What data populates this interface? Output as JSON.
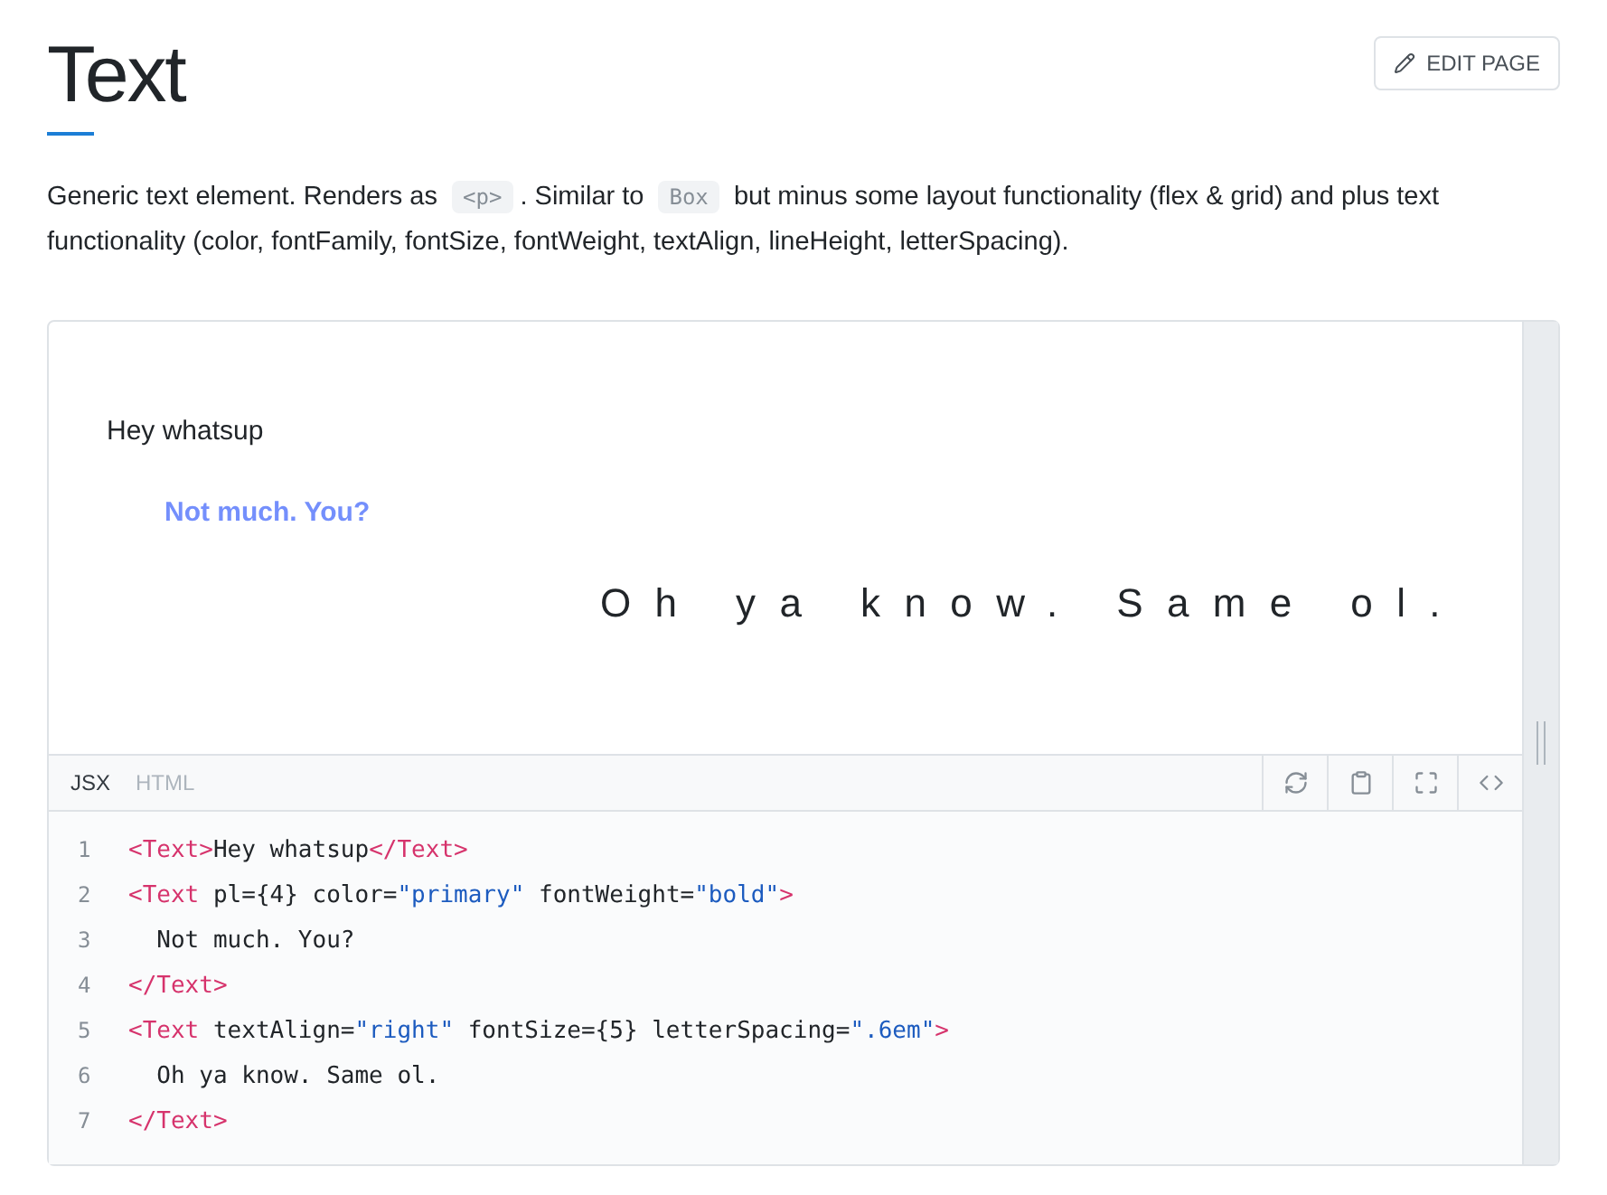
{
  "title": "Text",
  "edit_button": {
    "label": "EDIT PAGE"
  },
  "description": [
    {
      "kind": "text",
      "text": "Generic text element. Renders as "
    },
    {
      "kind": "code",
      "text": "<p>"
    },
    {
      "kind": "text",
      "text": ". Similar to "
    },
    {
      "kind": "code",
      "text": "Box"
    },
    {
      "kind": "text",
      "text": " but minus some layout functionality (flex & grid) and plus text functionality (color, fontFamily, fontSize, fontWeight, textAlign, lineHeight, letterSpacing)."
    }
  ],
  "preview": [
    {
      "kind": "plain",
      "text": "Hey whatsup"
    },
    {
      "kind": "bold",
      "text": "Not much. You?"
    },
    {
      "kind": "spaced",
      "text": "Oh ya know. Same ol."
    }
  ],
  "tabs": [
    {
      "label": "JSX",
      "selected": true
    },
    {
      "label": "HTML",
      "selected": false
    }
  ],
  "code_lines": [
    {
      "number": "1",
      "tokens": [
        {
          "kind": "tag",
          "text": "<Text>"
        },
        {
          "kind": "plain",
          "text": "Hey whatsup"
        },
        {
          "kind": "tag",
          "text": "</Text>"
        }
      ]
    },
    {
      "number": "2",
      "tokens": [
        {
          "kind": "tag",
          "text": "<Text"
        },
        {
          "kind": "plain",
          "text": " pl={4} color="
        },
        {
          "kind": "string",
          "text": "\"primary\""
        },
        {
          "kind": "plain",
          "text": " fontWeight="
        },
        {
          "kind": "string",
          "text": "\"bold\""
        },
        {
          "kind": "tag",
          "text": ">"
        }
      ]
    },
    {
      "number": "3",
      "tokens": [
        {
          "kind": "plain",
          "text": "  Not much. You?"
        }
      ]
    },
    {
      "number": "4",
      "tokens": [
        {
          "kind": "tag",
          "text": "</Text>"
        }
      ]
    },
    {
      "number": "5",
      "tokens": [
        {
          "kind": "tag",
          "text": "<Text"
        },
        {
          "kind": "plain",
          "text": " textAlign="
        },
        {
          "kind": "string",
          "text": "\"right\""
        },
        {
          "kind": "plain",
          "text": " fontSize={5} letterSpacing="
        },
        {
          "kind": "string",
          "text": "\".6em\""
        },
        {
          "kind": "tag",
          "text": ">"
        }
      ]
    },
    {
      "number": "6",
      "tokens": [
        {
          "kind": "plain",
          "text": "  Oh ya know. Same ol."
        }
      ]
    },
    {
      "number": "7",
      "tokens": [
        {
          "kind": "tag",
          "text": "</Text>"
        }
      ]
    }
  ]
}
